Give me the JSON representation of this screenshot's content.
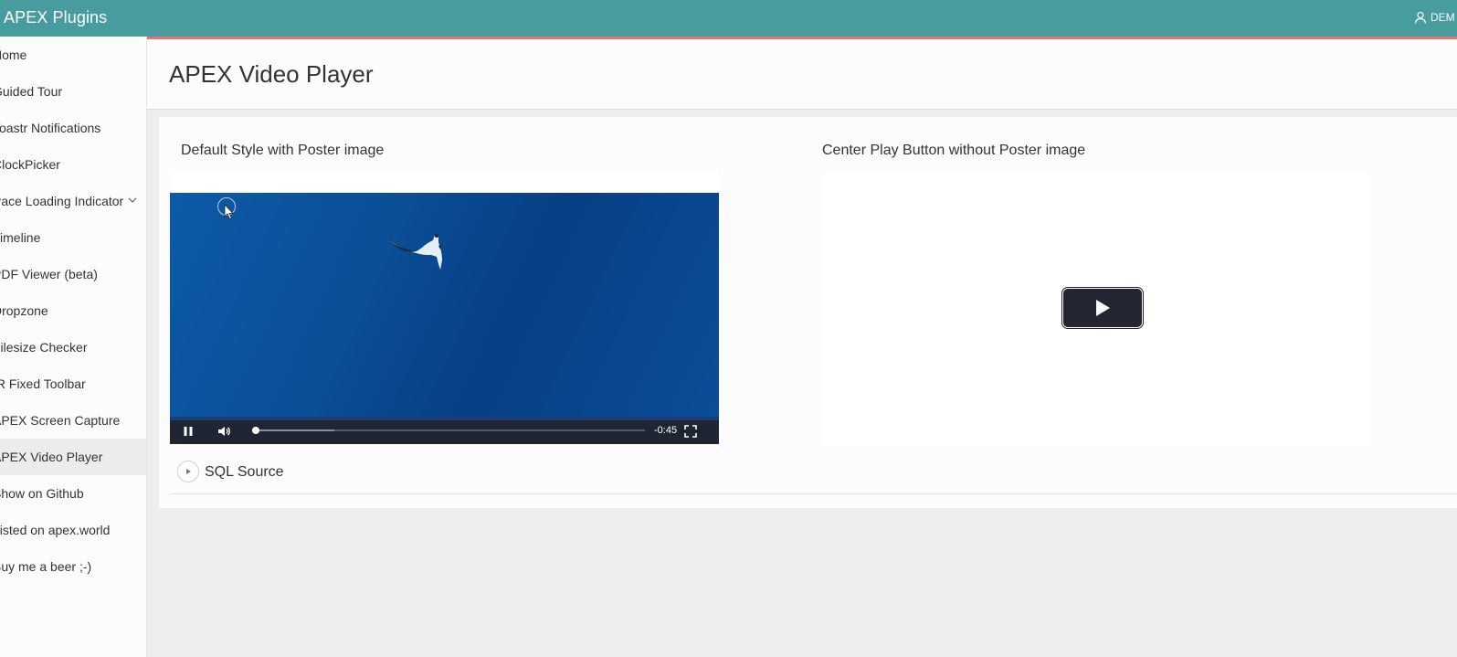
{
  "header": {
    "app_title": "APEX Plugins",
    "user_label": "DEM",
    "color": "#479d9d"
  },
  "sidebar": {
    "active_index": 11,
    "items": [
      {
        "label": "Home"
      },
      {
        "label": "Guided Tour"
      },
      {
        "label": "Toastr Notifications"
      },
      {
        "label": "ClockPicker"
      },
      {
        "label": "Pace Loading Indicator",
        "has_children": true
      },
      {
        "label": "Timeline"
      },
      {
        "label": "PDF Viewer (beta)"
      },
      {
        "label": "Dropzone"
      },
      {
        "label": "Filesize Checker"
      },
      {
        "label": "IR Fixed Toolbar"
      },
      {
        "label": "APEX Screen Capture"
      },
      {
        "label": "APEX Video Player"
      },
      {
        "label": "Show on Github"
      },
      {
        "label": "Listed on apex.world"
      },
      {
        "label": "Buy me a beer ;-)"
      }
    ]
  },
  "page": {
    "title": "APEX Video Player"
  },
  "region": {
    "left_card_title": "Default Style with Poster image",
    "right_card_title": "Center Play Button without Poster image",
    "video1": {
      "time_remaining": "-0:45",
      "progress_fraction": 0.01,
      "buffered_fraction": 0.21,
      "state": "playing"
    },
    "video2": {
      "state": "paused"
    },
    "sql_source_label": "SQL Source"
  }
}
